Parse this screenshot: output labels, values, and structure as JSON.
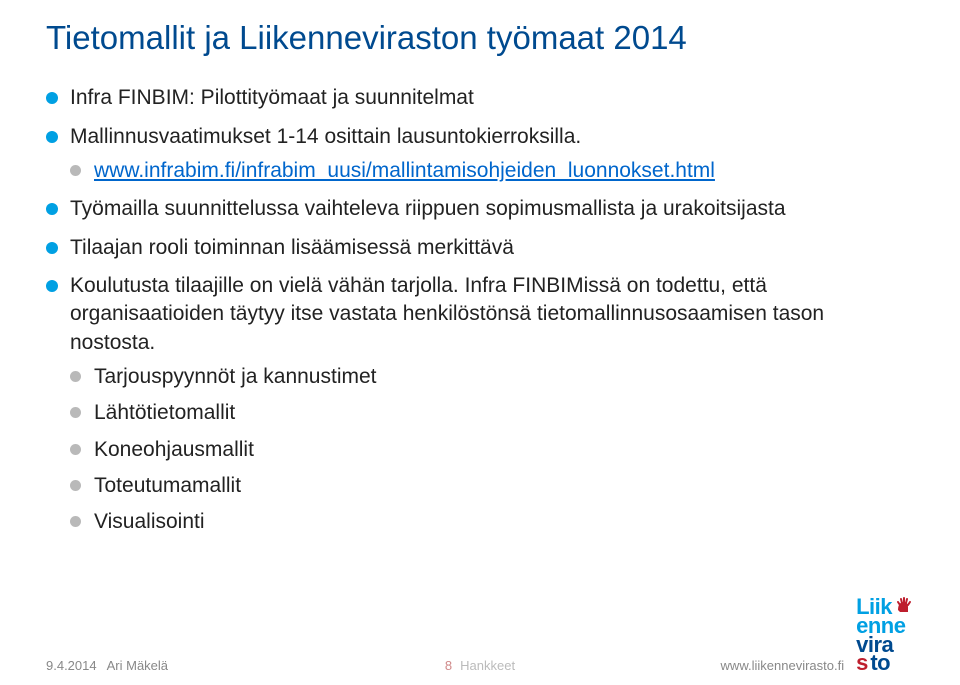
{
  "title": "Tietomallit ja Liikenneviraston työmaat 2014",
  "bullets": {
    "b1": "Infra FINBIM: Pilottityömaat ja suunnitelmat",
    "b2": "Mallinnusvaatimukset 1-14 osittain lausuntokierroksilla.",
    "b2_link": "www.infrabim.fi/infrabim_uusi/mallintamisohjeiden_luonnokset.html",
    "b3": "Työmailla suunnittelussa vaihteleva riippuen sopimusmallista ja urakoitsijasta",
    "b4": "Tilaajan rooli toiminnan lisäämisessä merkittävä",
    "b5": "Koulutusta tilaajille on vielä vähän tarjolla. Infra FINBIMissä on todettu, että organisaatioiden täytyy itse vastata henkilöstönsä tietomallinnusosaamisen tason nostosta.",
    "sub1": "Tarjouspyynnöt ja kannustimet",
    "sub2": "Lähtötietomallit",
    "sub3": "Koneohjausmallit",
    "sub4": "Toteutumamallit",
    "sub5": "Visualisointi"
  },
  "footer": {
    "date": "9.4.2014",
    "author": "Ari Mäkelä",
    "page": "8",
    "section": "Hankkeet",
    "url": "www.liikennevirasto.fi",
    "logo_line1a": "Liik",
    "logo_line1b": "enne",
    "logo_line2a": "vira",
    "logo_line2b_s": "s",
    "logo_line2b_to": "to"
  }
}
